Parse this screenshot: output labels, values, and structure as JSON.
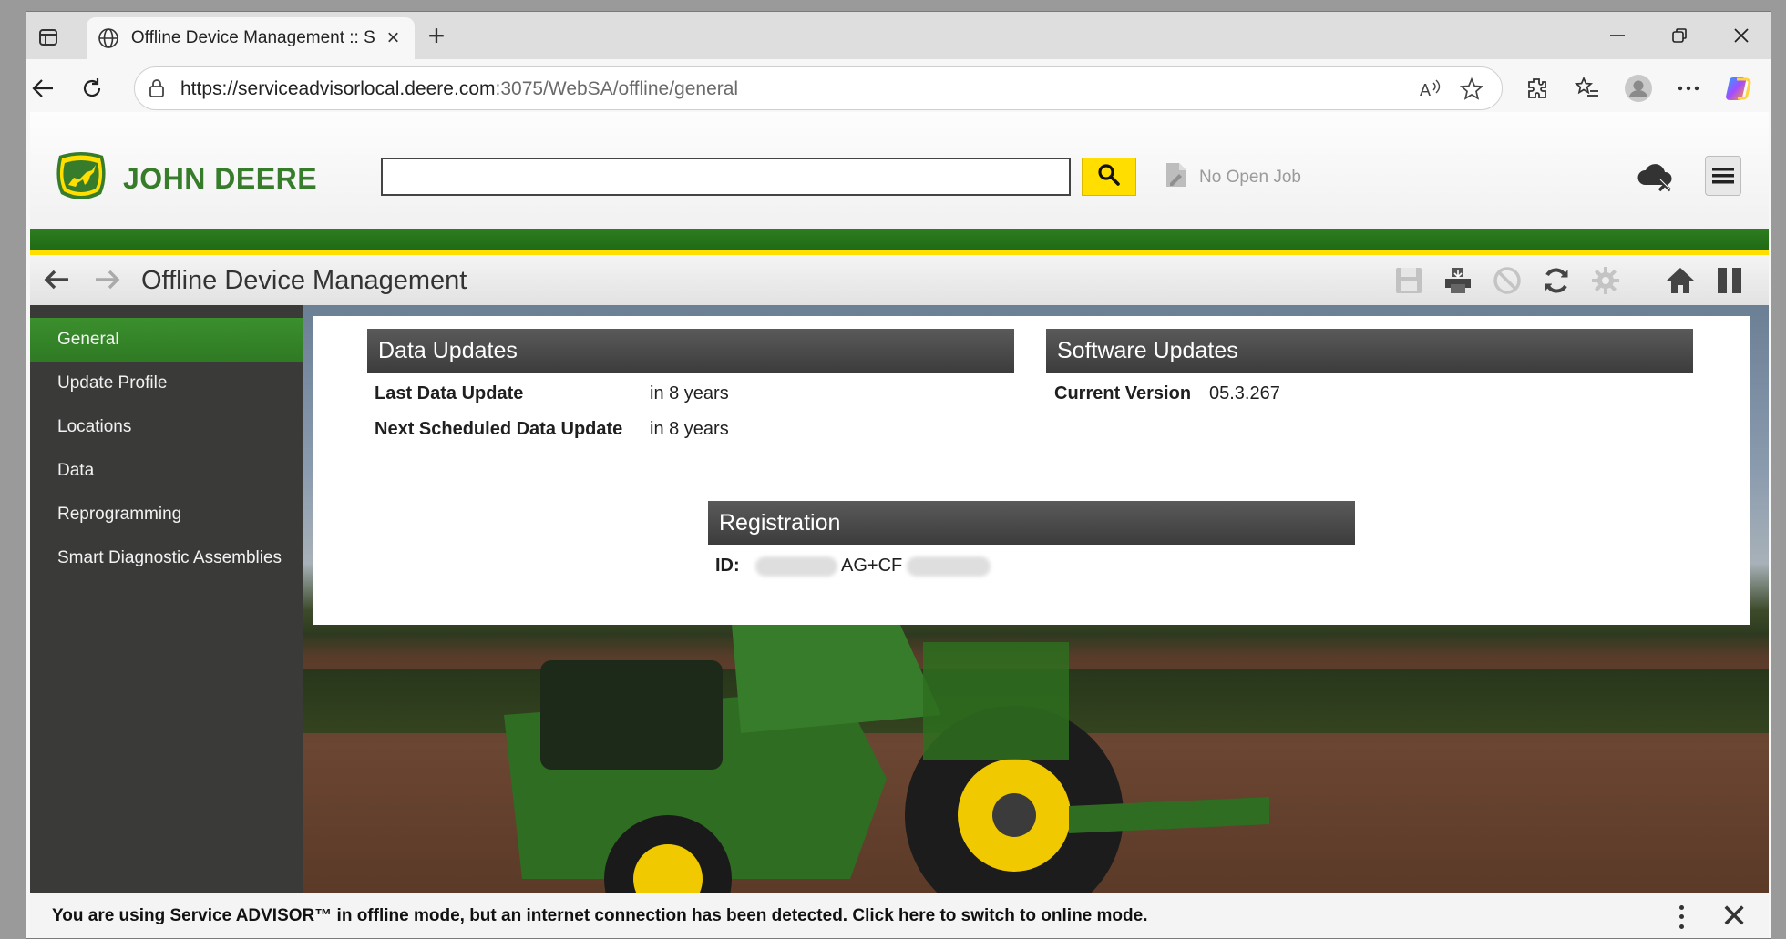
{
  "browser": {
    "tab_title": "Offline Device Management :: Ser",
    "url_host": "https://serviceadvisorlocal.deere.com",
    "url_path": ":3075/WebSA/offline/general"
  },
  "app": {
    "brand": "JOHN DEERE",
    "search": {
      "value": "",
      "placeholder": ""
    },
    "no_job_label": "No Open Job",
    "page_title": "Offline Device Management"
  },
  "sidebar": {
    "items": [
      {
        "label": "General",
        "active": true
      },
      {
        "label": "Update Profile",
        "active": false
      },
      {
        "label": "Locations",
        "active": false
      },
      {
        "label": "Data",
        "active": false
      },
      {
        "label": "Reprogramming",
        "active": false
      },
      {
        "label": "Smart Diagnostic Assemblies",
        "active": false
      }
    ]
  },
  "data_updates": {
    "title": "Data Updates",
    "last_label": "Last Data Update",
    "last_value": "in 8 years",
    "next_label": "Next Scheduled Data Update",
    "next_value": "in 8 years"
  },
  "software_updates": {
    "title": "Software Updates",
    "version_label": "Current Version",
    "version_value": "05.3.267"
  },
  "registration": {
    "title": "Registration",
    "id_label": "ID:",
    "id_visible": "AG+CF"
  },
  "offline_banner": {
    "message": "You are using Service ADVISOR™ in offline mode, but an internet connection has been detected. Click here to switch to online mode."
  },
  "colors": {
    "jd_green": "#367c2b",
    "jd_yellow": "#ffde00",
    "sidebar_bg": "#3a3b39",
    "header_dark": "#3c3c3c"
  },
  "icons": [
    "tab-actions-icon",
    "globe-icon",
    "close-icon",
    "new-tab-icon",
    "minimize-icon",
    "restore-icon",
    "window-close-icon",
    "back-icon",
    "refresh-icon",
    "lock-icon",
    "read-aloud-icon",
    "favorite-icon",
    "extensions-icon",
    "favorites-list-icon",
    "profile-icon",
    "more-icon",
    "copilot-icon",
    "jd-deer-logo-icon",
    "search-icon",
    "job-icon",
    "cloud-offline-icon",
    "hamburger-icon",
    "nav-back-icon",
    "nav-forward-icon",
    "save-icon",
    "print-icon",
    "cancel-icon",
    "sync-icon",
    "settings-icon",
    "home-icon",
    "pause-icon",
    "kebab-icon",
    "dismiss-icon"
  ]
}
